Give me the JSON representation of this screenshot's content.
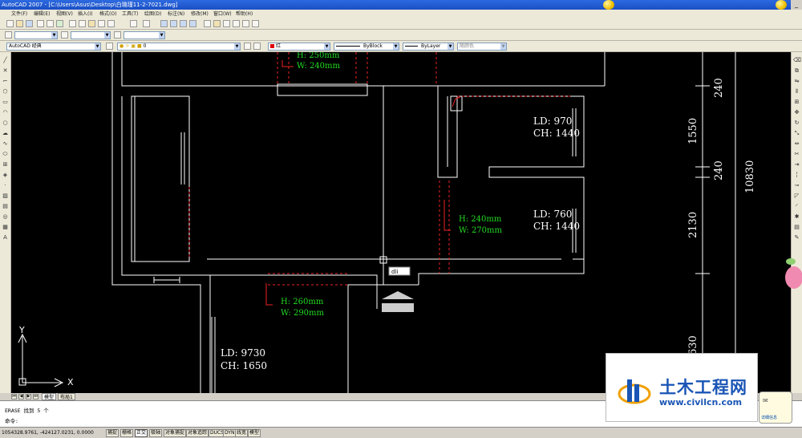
{
  "window": {
    "title": "AutoCAD 2007 - [C:\\Users\\Asus\\Desktop\\白璐瑾11-2-7021.dwg]",
    "minimize_glyph": "_"
  },
  "menu": [
    "文件(F)",
    "编辑(E)",
    "视图(V)",
    "插入(I)",
    "格式(O)",
    "工具(T)",
    "绘图(D)",
    "标注(N)",
    "修改(M)",
    "窗口(W)",
    "帮助(H)"
  ],
  "workspace": {
    "value": "AutoCAD 经典"
  },
  "layer": {
    "value": "0"
  },
  "color_combo": {
    "value": "红"
  },
  "linetype_combo": {
    "value": "ByBlock"
  },
  "lineweight_combo": {
    "value": "ByLayer"
  },
  "plotstyle_combo": {
    "value": "随颜色"
  },
  "drawing": {
    "tags": [
      {
        "h": "H: 250mm",
        "w": "W: 240mm"
      },
      {
        "h": "H: 240mm",
        "w": "W: 270mm"
      },
      {
        "h": "H: 260mm",
        "w": "W: 290mm"
      }
    ],
    "rooms": [
      {
        "ld": "LD: 970",
        "ch": "CH: 1440"
      },
      {
        "ld": "LD: 760",
        "ch": "CH: 1440"
      },
      {
        "ld": "LD: 9730",
        "ch": "CH: 1650"
      }
    ],
    "dimensions": [
      "240",
      "1550",
      "240",
      "2130",
      "630",
      "10830"
    ],
    "cursor_tooltip": "dli",
    "ucs": {
      "x": "X",
      "y": "Y"
    }
  },
  "layout_tabs": {
    "model": "模型",
    "layout": "布局1"
  },
  "command": {
    "history": "ERASE 找到 5 个",
    "prompt": "命令:"
  },
  "status": {
    "coords": "1054328.9761, -424127.0231, 0.0000",
    "toggles": [
      "捕捉",
      "栅格",
      "正交",
      "极轴",
      "对象捕捉",
      "对象追踪",
      "DUCS",
      "DYN",
      "线宽",
      "模型"
    ],
    "active_toggles": [
      "正交"
    ]
  },
  "notification": {
    "text": "详细信息"
  },
  "watermark": {
    "title": "土木工程网",
    "url": "www.civilcn.com"
  },
  "colors": {
    "canvas": "#000000",
    "wall": "#ffffff",
    "tag": "#22dd22",
    "dashed": "#ee2222",
    "title_bar": "#2d6ae0",
    "brand": "#1a55b5"
  }
}
